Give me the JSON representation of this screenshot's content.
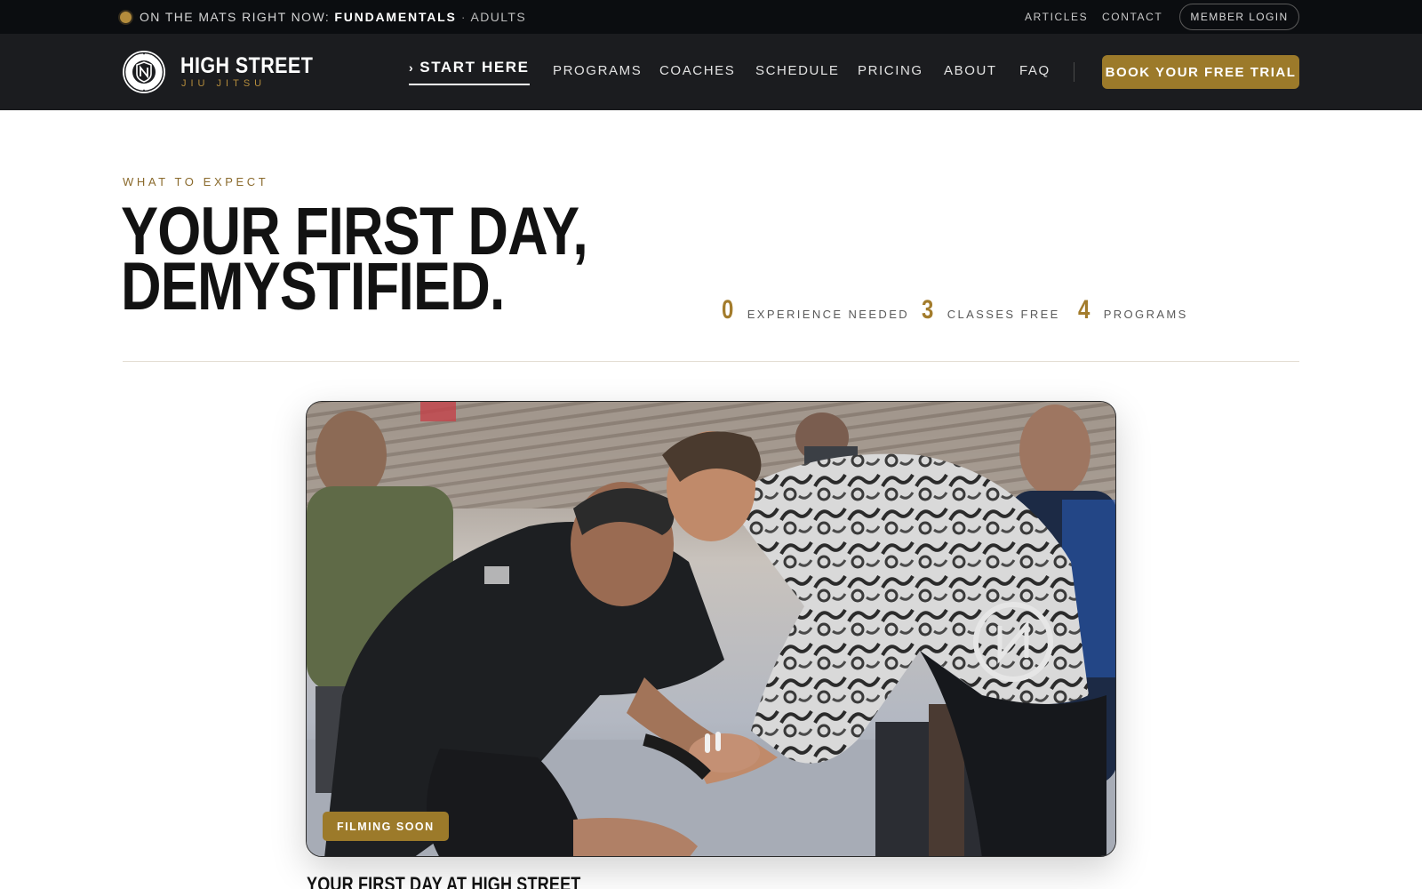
{
  "topbar": {
    "announcement_prefix": "ON THE MATS RIGHT NOW:",
    "current_class": "FUNDAMENTALS",
    "separator": "·",
    "current_group": "ADULTS",
    "links": [
      "ARTICLES",
      "CONTACT"
    ],
    "member_login": "MEMBER LOGIN"
  },
  "brand": {
    "name": "HIGH STREET",
    "subtitle": "JIU JITSU",
    "seal_text_top": "HIGH STREET",
    "seal_text_bottom": "JIU JITSU"
  },
  "nav": {
    "active_label": "START HERE",
    "items": [
      "PROGRAMS",
      "COACHES",
      "SCHEDULE",
      "PRICING",
      "ABOUT",
      "FAQ"
    ],
    "cta": "BOOK YOUR FREE TRIAL"
  },
  "hero": {
    "eyebrow": "WHAT TO EXPECT",
    "headline_line1": "YOUR FIRST DAY,",
    "headline_line2": "DEMYSTIFIED.",
    "stats": [
      {
        "value": "0",
        "label": "EXPERIENCE NEEDED"
      },
      {
        "value": "3",
        "label": "CLASSES FREE"
      },
      {
        "value": "4",
        "label": "PROGRAMS"
      }
    ]
  },
  "media": {
    "badge": "FILMING SOON",
    "caption": "YOUR FIRST DAY AT HIGH STREET"
  },
  "colors": {
    "accent_gold": "#9c7a2a",
    "topbar_bg": "#0b0d10",
    "navbar_bg": "#1b1c1f"
  }
}
